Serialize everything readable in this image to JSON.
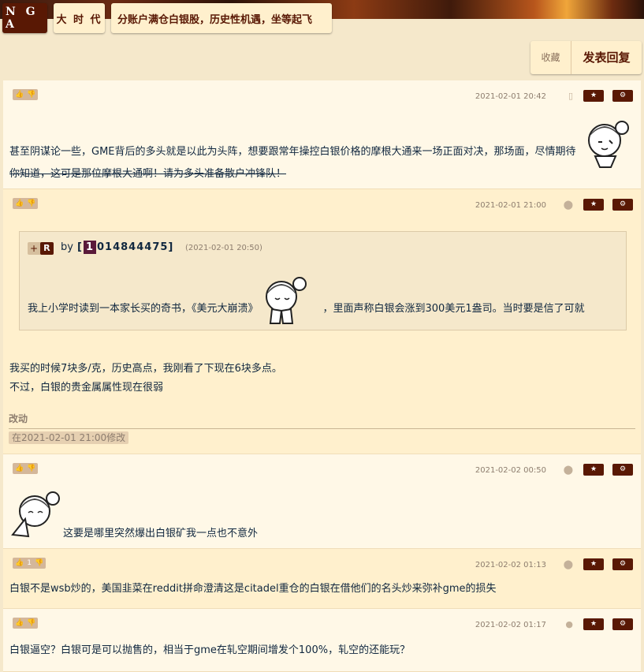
{
  "header": {
    "logo": "N G A",
    "forum": "大 时 代",
    "thread_title": "分账户满仓白银股，历史性机遇，坐等起飞"
  },
  "actions": {
    "favorite": "收藏",
    "reply": "发表回复"
  },
  "icons": {
    "thumbs_up": "thumbs-up-icon",
    "thumbs_down": "thumbs-down-icon",
    "star": "star-icon",
    "gear": "gear-icon",
    "phone": "phone-icon",
    "android": "android-icon",
    "apple": "apple-icon"
  },
  "colors": {
    "brand": "#591804",
    "bg": "#f5e8cb",
    "row_light": "#fff8e7",
    "row_dark": "#fff0cd",
    "text": "#10273f"
  },
  "posts": [
    {
      "date": "2021-02-01 20:42",
      "vote_count": "",
      "line1": "甚至阴谋论一些，GME背后的多头就是以此为头阵，想要跟常年操控白银价格的摩根大通来一场正面对决，那场面，尽情期待",
      "line2": "你知道，这可是那位摩根大通啊！请为多头准备散户冲锋队！"
    },
    {
      "date": "2021-02-01 21:00",
      "vote_count": "",
      "quote": {
        "plus": "+",
        "r": "R",
        "by": "by",
        "user_open": "[",
        "user_first": "1",
        "user_rest": "014844475]",
        "time": "(2021-02-01 20:50)",
        "text_before": "我上小学时读到一本家长买的奇书，《美元大崩溃》",
        "text_after": "，里面声称白银会涨到300美元1盎司。当时要是信了可就"
      },
      "line1": "我买的时候7块多/克，历史高点，我刚看了下现在6块多点。",
      "line2": "不过，白银的贵金属属性现在很弱",
      "edit_header": "改动",
      "edit_note": "在2021-02-01 21:00修改"
    },
    {
      "date": "2021-02-02 00:50",
      "vote_count": "",
      "line1": "这要是哪里突然爆出白银矿我一点也不意外"
    },
    {
      "date": "2021-02-02 01:13",
      "vote_count": "1",
      "line1": "白银不是wsb炒的，美国韭菜在reddit拼命澄清这是citadel重仓的白银在借他们的名头炒来弥补gme的损失"
    },
    {
      "date": "2021-02-02 01:17",
      "vote_count": "",
      "line1": "白银逼空？白银可是可以抛售的，相当于gme在轧空期间增发个100%，轧空的还能玩？"
    }
  ]
}
